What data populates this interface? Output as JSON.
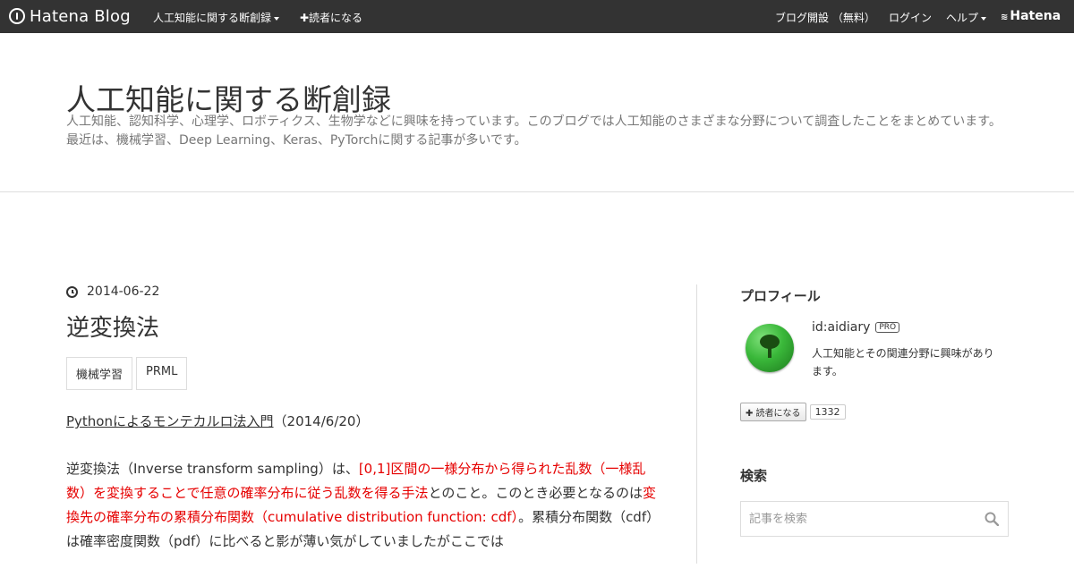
{
  "topbar": {
    "brand": "Hatena Blog",
    "blog_menu": "人工知能に関する断創録",
    "subscribe": "✚読者になる",
    "open_blog": "ブログ開設 （無料）",
    "login": "ログイン",
    "help": "ヘルプ",
    "hatena": "Hatena"
  },
  "header": {
    "title": "人工知能に関する断創録",
    "description": "人工知能、認知科学、心理学、ロボティクス、生物学などに興味を持っています。このブログでは人工知能のさまざまな分野について調査したことをまとめています。最近は、機械学習、Deep Learning、Keras、PyTorchに関する記事が多いです。"
  },
  "entry": {
    "date": "2014-06-22",
    "title": "逆変換法",
    "categories": [
      "機械学習",
      "PRML"
    ],
    "link_text": "Pythonによるモンテカルロ法入門",
    "link_suffix": "（2014/6/20）",
    "p2_a": "逆変換法（Inverse transform sampling）は、",
    "p2_b": "[0,1]区間の一様分布から得られた乱数（一様乱数）を変換することで任意の確率分布に従う乱数を得る手法",
    "p2_c": "とのこと。このとき必要となるのは",
    "p2_d": "変換先の確率分布の累積分布関数（cumulative distribution function: cdf）",
    "p2_e": "。累積分布関数（cdf）は確率密度関数（pdf）に比べると影が薄い気がしていましたがここでは"
  },
  "sidebar": {
    "profile_heading": "プロフィール",
    "profile_id": "id:aidiary",
    "pro_badge": "PRO",
    "profile_desc": "人工知能とその関連分野に興味があります。",
    "subscribe_button": "✚ 読者になる",
    "subscriber_count": "1332",
    "search_heading": "検索",
    "search_placeholder": "記事を検索"
  }
}
